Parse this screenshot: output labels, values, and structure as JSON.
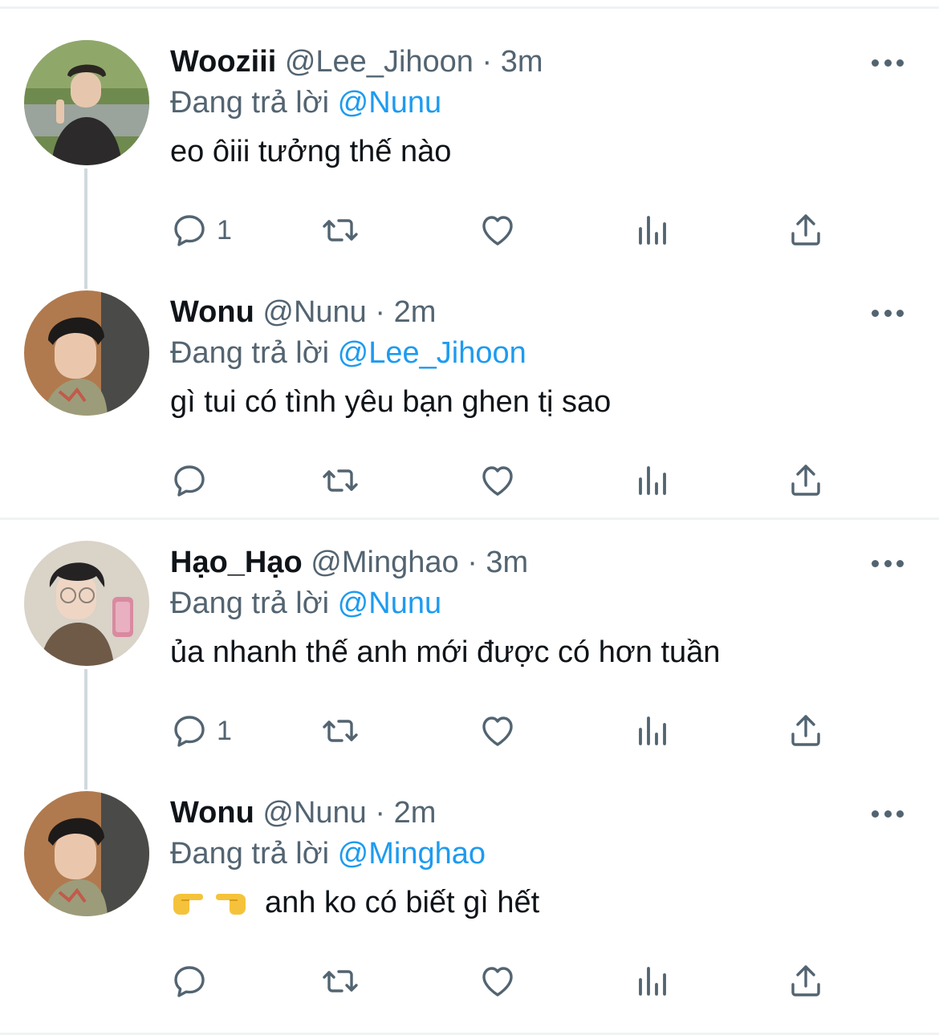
{
  "tweets": [
    {
      "name": "Wooziii",
      "handle": "@Lee_Jihoon",
      "separator": "·",
      "time": "3m",
      "reply_prefix": "Đang trả lời",
      "reply_to": "@Nunu",
      "text": "eo ôiii tưởng thế nào",
      "reply_count": "1"
    },
    {
      "name": "Wonu",
      "handle": "@Nunu",
      "separator": "·",
      "time": "2m",
      "reply_prefix": "Đang trả lời",
      "reply_to": "@Lee_Jihoon",
      "text": "gì tui có tình yêu bạn ghen tị sao",
      "reply_count": ""
    },
    {
      "name": "Hạo_Hạo",
      "handle": "@Minghao",
      "separator": "·",
      "time": "3m",
      "reply_prefix": "Đang trả lời",
      "reply_to": "@Nunu",
      "text": "ủa nhanh thế anh mới được có hơn tuần",
      "reply_count": "1"
    },
    {
      "name": "Wonu",
      "handle": "@Nunu",
      "separator": "·",
      "time": "2m",
      "reply_prefix": "Đang trả lời",
      "reply_to": "@Minghao",
      "text": "anh ko có biết gì hết",
      "emojis": [
        "backhand-index-pointing-right",
        "backhand-index-pointing-left"
      ],
      "reply_count": ""
    }
  ],
  "icons": {
    "reply": "reply-icon",
    "retweet": "retweet-icon",
    "like": "like-icon",
    "views": "views-icon",
    "share": "share-icon",
    "more": "more-icon"
  },
  "colors": {
    "name": "#0f1419",
    "secondary": "#536471",
    "mention": "#1d9bf0",
    "divider": "#eff3f4",
    "thread_line": "#cfd9de"
  }
}
